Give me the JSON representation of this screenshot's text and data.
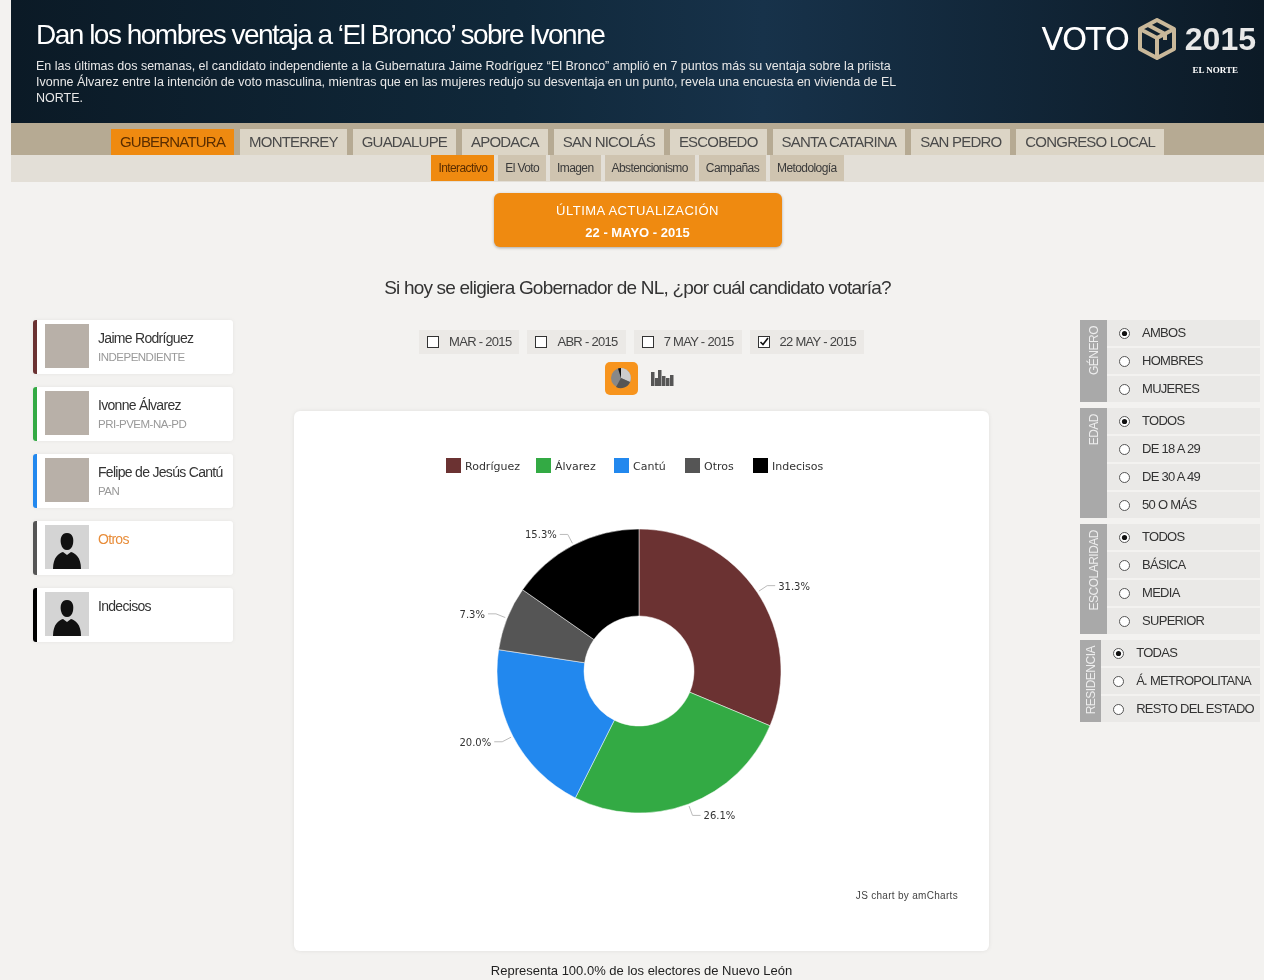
{
  "header": {
    "title": "Dan los hombres ventaja a ‘El Bronco’ sobre Ivonne",
    "summary": "En las últimas dos semanas, el candidato independiente a la Gubernatura Jaime Rodríguez “El Bronco” amplió en 7 puntos más su ventaja sobre la priista Ivonne Álvarez entre la intención de voto masculina, mientras que en las mujeres redujo su desventaja en un punto, revela una encuesta en vivienda de EL NORTE.",
    "logo_word": "VOTO",
    "logo_year": "2015",
    "logo_brand": "EL NORTE"
  },
  "nav_tabs": [
    {
      "label": "GUBERNATURA",
      "selected": true
    },
    {
      "label": "MONTERREY",
      "selected": false
    },
    {
      "label": "GUADALUPE",
      "selected": false
    },
    {
      "label": "APODACA",
      "selected": false
    },
    {
      "label": "SAN NICOLÁS",
      "selected": false
    },
    {
      "label": "ESCOBEDO",
      "selected": false
    },
    {
      "label": "SANTA CATARINA",
      "selected": false
    },
    {
      "label": "SAN PEDRO",
      "selected": false
    },
    {
      "label": "CONGRESO LOCAL",
      "selected": false
    }
  ],
  "sub_tabs": [
    {
      "label": "Interactivo",
      "selected": true
    },
    {
      "label": "El Voto",
      "selected": false
    },
    {
      "label": "Imagen",
      "selected": false
    },
    {
      "label": "Abstencionismo",
      "selected": false
    },
    {
      "label": "Campañas",
      "selected": false
    },
    {
      "label": "Metodología",
      "selected": false
    }
  ],
  "update_badge": {
    "line_1": "ÚLTIMA ACTUALIZACIÓN",
    "line_2": "22 - MAYO - 2015"
  },
  "question": "Si hoy se eligiera Gobernador de NL, ¿por cuál candidato votaría?",
  "candidates": [
    {
      "name": "Jaime Rodríguez",
      "party": "INDEPENDIENTE",
      "color": "#6b3232",
      "kind": "photo",
      "selected": false
    },
    {
      "name": "Ivonne Álvarez",
      "party": "PRI-PVEM-NA-PD",
      "color": "#33aa44",
      "kind": "photo",
      "selected": false
    },
    {
      "name": "Felipe de Jesús Cantú",
      "party": "PAN",
      "color": "#2288ee",
      "kind": "photo",
      "selected": false
    },
    {
      "name": "Otros",
      "color": "#555555",
      "kind": "silhouette",
      "selected": true
    },
    {
      "name": "Indecisos",
      "color": "#000000",
      "kind": "silhouette",
      "selected": false
    }
  ],
  "dates": [
    {
      "label": "MAR - 2015",
      "checked": false
    },
    {
      "label": "ABR - 2015",
      "checked": false
    },
    {
      "label": "7 MAY - 2015",
      "checked": false
    },
    {
      "label": "22 MAY - 2015",
      "checked": true
    }
  ],
  "chart_types": [
    {
      "kind": "pie",
      "selected": true
    },
    {
      "kind": "bar",
      "selected": false
    }
  ],
  "chart": {
    "chart_data": {
      "type": "donut",
      "categories": [
        "Rodríguez",
        "Álvarez",
        "Cantú",
        "Otros",
        "Indecisos"
      ],
      "values": [
        31.3,
        26.1,
        20.0,
        7.3,
        15.3
      ],
      "legend": "top",
      "colors": [
        "#6b3232",
        "#33aa44",
        "#2288ee",
        "#555555",
        "#000000"
      ],
      "value_labels": [
        "31.3%",
        "26.1%",
        "20.0%",
        "7.3%",
        "15.3%"
      ]
    },
    "credit": "JS chart by amCharts"
  },
  "footnote": "Representa 100.0% de los electores de Nuevo León",
  "filters": [
    {
      "label": "GÉNERO",
      "options": [
        {
          "label": "AMBOS",
          "selected": true
        },
        {
          "label": "HOMBRES",
          "selected": false
        },
        {
          "label": "MUJERES",
          "selected": false
        }
      ]
    },
    {
      "label": "EDAD",
      "options": [
        {
          "label": "TODOS",
          "selected": true
        },
        {
          "label": "DE 18 A 29",
          "selected": false
        },
        {
          "label": "DE 30 A 49",
          "selected": false
        },
        {
          "label": "50 O MÁS",
          "selected": false
        }
      ]
    },
    {
      "label": "ESCOLARIDAD",
      "options": [
        {
          "label": "TODOS",
          "selected": true
        },
        {
          "label": "BÁSICA",
          "selected": false
        },
        {
          "label": "MEDIA",
          "selected": false
        },
        {
          "label": "SUPERIOR",
          "selected": false
        }
      ]
    },
    {
      "label": "RESIDENCIA",
      "options": [
        {
          "label": "TODAS",
          "selected": true
        },
        {
          "label": "Á. METROPOLITANA",
          "selected": false
        },
        {
          "label": "RESTO DEL ESTADO",
          "selected": false
        }
      ]
    }
  ]
}
